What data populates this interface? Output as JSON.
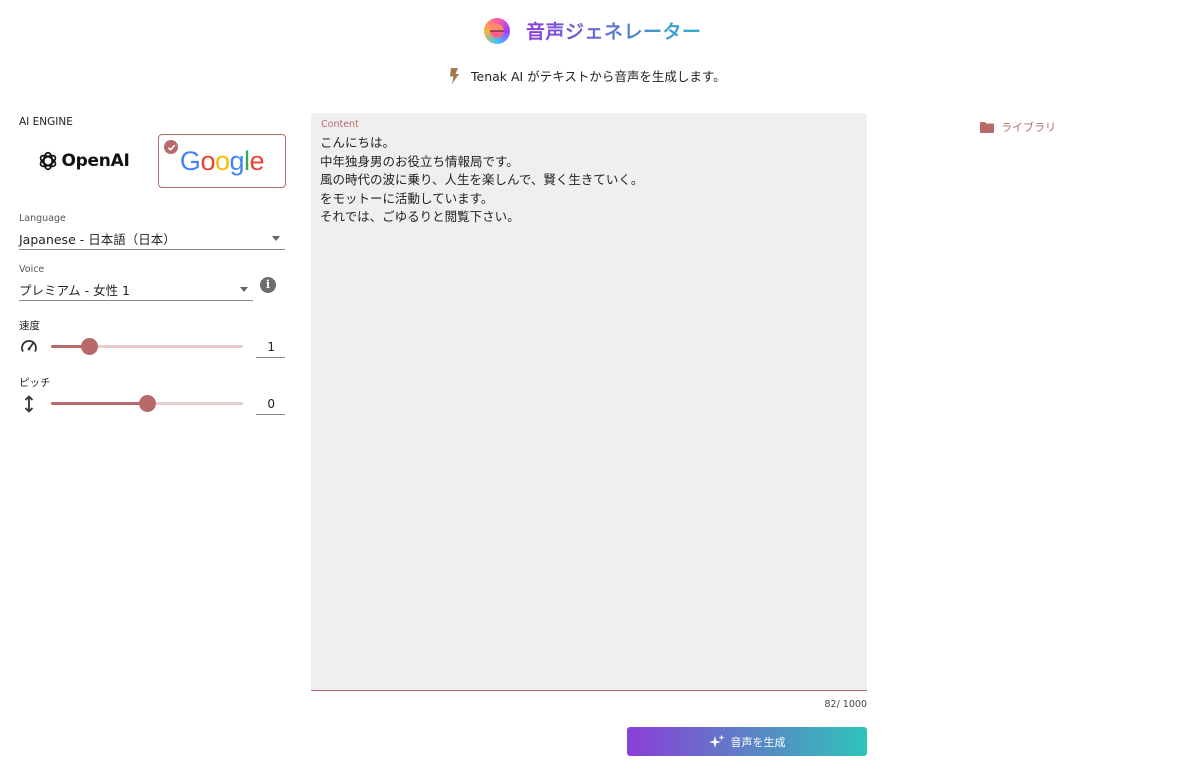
{
  "header": {
    "title": "音声ジェネレーター",
    "subtitle": "Tenak AI がテキストから音声を生成します。",
    "logo_icon": "app-logo-icon",
    "bolt_icon": "bolt-icon"
  },
  "engine": {
    "label": "AI ENGINE",
    "options": [
      {
        "name": "OpenAI",
        "selected": false
      },
      {
        "name": "Google",
        "selected": true
      }
    ]
  },
  "language": {
    "label": "Language",
    "value": "Japanese - 日本語（日本）"
  },
  "voice": {
    "label": "Voice",
    "value": "プレミアム - 女性 1",
    "info_icon": "info-icon"
  },
  "speed": {
    "label": "速度",
    "value": "1",
    "fraction": 0.2,
    "icon": "speedometer-icon"
  },
  "pitch": {
    "label": "ピッチ",
    "value": "0",
    "fraction": 0.5,
    "icon": "vertical-arrows-icon"
  },
  "content": {
    "label": "Content",
    "text": "こんにちは。\n中年独身男のお役立ち情報局です。\n風の時代の波に乗り、人生を楽しんで、賢く生きていく。\nをモットーに活動しています。\nそれでは、ごゆるりと閲覧下さい。",
    "char_count": "82/ 1000"
  },
  "generate_button": {
    "label": "音声を生成",
    "icon": "sparkle-icon"
  },
  "library": {
    "label": "ライブラリ",
    "icon": "folder-icon"
  },
  "colors": {
    "accent": "#b86a6a",
    "gradient_start": "#8a3fd6",
    "gradient_end": "#2fc4b8",
    "content_bg": "#efefef"
  }
}
